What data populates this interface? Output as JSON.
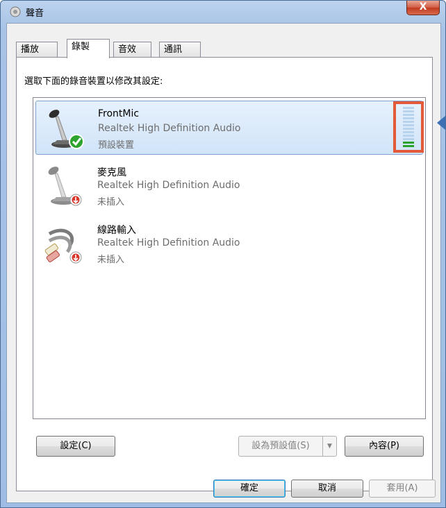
{
  "window": {
    "title": "聲音",
    "close_label": "X"
  },
  "tabs": [
    {
      "label": "播放",
      "active": false
    },
    {
      "label": "錄製",
      "active": true
    },
    {
      "label": "音效",
      "active": false
    },
    {
      "label": "通訊",
      "active": false
    }
  ],
  "instruction": "選取下面的錄音裝置以修改其設定:",
  "devices": [
    {
      "name": "FrontMic",
      "driver": "Realtek High Definition Audio",
      "status": "預設裝置",
      "icon": "microphone-default-icon",
      "selected": true,
      "level_bars_lit": 2,
      "level_bars_total": 12
    },
    {
      "name": "麥克風",
      "driver": "Realtek High Definition Audio",
      "status": "未插入",
      "icon": "microphone-unplugged-icon",
      "selected": false
    },
    {
      "name": "線路輸入",
      "driver": "Realtek High Definition Audio",
      "status": "未插入",
      "icon": "line-in-unplugged-icon",
      "selected": false
    }
  ],
  "buttons": {
    "configure": "設定(C)",
    "set_default": "設為預設值(S)",
    "properties": "內容(P)",
    "ok": "確定",
    "cancel": "取消",
    "apply": "套用(A)"
  },
  "colors": {
    "accent_highlight": "#e35a3b",
    "meter_on": "#2aa12a",
    "selection": "#d1e4f9"
  }
}
